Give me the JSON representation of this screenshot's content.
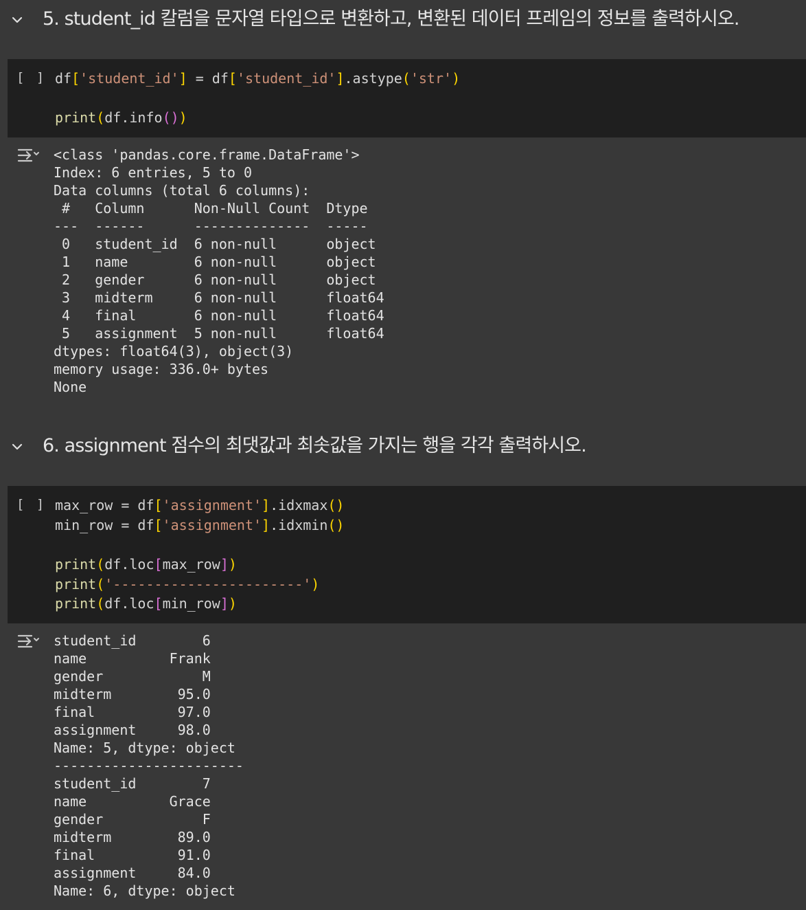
{
  "sections": [
    {
      "title": "5. student_id 칼럼을 문자열 타입으로 변환하고, 변환된 데이터 프레임의 정보를 출력하시오.",
      "run_label": "[ ]",
      "code": [
        [
          [
            "plain",
            "df"
          ],
          [
            "br1",
            "["
          ],
          [
            "str",
            "'student_id'"
          ],
          [
            "br1",
            "]"
          ],
          [
            "plain",
            " = df"
          ],
          [
            "br1",
            "["
          ],
          [
            "str",
            "'student_id'"
          ],
          [
            "br1",
            "]"
          ],
          [
            "plain",
            ".astype"
          ],
          [
            "br1",
            "("
          ],
          [
            "str",
            "'str'"
          ],
          [
            "br1",
            ")"
          ]
        ],
        [],
        [
          [
            "fn",
            "print"
          ],
          [
            "br1",
            "("
          ],
          [
            "plain",
            "df.info"
          ],
          [
            "br2",
            "()"
          ],
          [
            "br1",
            ")"
          ]
        ]
      ],
      "output": [
        "<class 'pandas.core.frame.DataFrame'>",
        "Index: 6 entries, 5 to 0",
        "Data columns (total 6 columns):",
        " #   Column      Non-Null Count  Dtype  ",
        "---  ------      --------------  -----  ",
        " 0   student_id  6 non-null      object ",
        " 1   name        6 non-null      object ",
        " 2   gender      6 non-null      object ",
        " 3   midterm     6 non-null      float64",
        " 4   final       6 non-null      float64",
        " 5   assignment  5 non-null      float64",
        "dtypes: float64(3), object(3)",
        "memory usage: 336.0+ bytes",
        "None"
      ]
    },
    {
      "title": "6. assignment 점수의 최댓값과 최솟값을 가지는 행을 각각 출력하시오.",
      "run_label": "[ ]",
      "code": [
        [
          [
            "plain",
            "max_row = df"
          ],
          [
            "br1",
            "["
          ],
          [
            "str",
            "'assignment'"
          ],
          [
            "br1",
            "]"
          ],
          [
            "plain",
            ".idxmax"
          ],
          [
            "br1",
            "()"
          ]
        ],
        [
          [
            "plain",
            "min_row = df"
          ],
          [
            "br1",
            "["
          ],
          [
            "str",
            "'assignment'"
          ],
          [
            "br1",
            "]"
          ],
          [
            "plain",
            ".idxmin"
          ],
          [
            "br1",
            "()"
          ]
        ],
        [],
        [
          [
            "fn",
            "print"
          ],
          [
            "br1",
            "("
          ],
          [
            "plain",
            "df.loc"
          ],
          [
            "br2",
            "["
          ],
          [
            "plain",
            "max_row"
          ],
          [
            "br2",
            "]"
          ],
          [
            "br1",
            ")"
          ]
        ],
        [
          [
            "fn",
            "print"
          ],
          [
            "br1",
            "("
          ],
          [
            "str",
            "'-----------------------'"
          ],
          [
            "br1",
            ")"
          ]
        ],
        [
          [
            "fn",
            "print"
          ],
          [
            "br1",
            "("
          ],
          [
            "plain",
            "df.loc"
          ],
          [
            "br2",
            "["
          ],
          [
            "plain",
            "min_row"
          ],
          [
            "br2",
            "]"
          ],
          [
            "br1",
            ")"
          ]
        ]
      ],
      "output": [
        "student_id        6",
        "name          Frank",
        "gender            M",
        "midterm        95.0",
        "final          97.0",
        "assignment     98.0",
        "Name: 5, dtype: object",
        "-----------------------",
        "student_id        7",
        "name          Grace",
        "gender            F",
        "midterm        89.0",
        "final          91.0",
        "assignment     84.0",
        "Name: 6, dtype: object"
      ]
    }
  ],
  "icons": {
    "chevron": "chevron-down-icon",
    "output": "output-toggle-icon"
  }
}
